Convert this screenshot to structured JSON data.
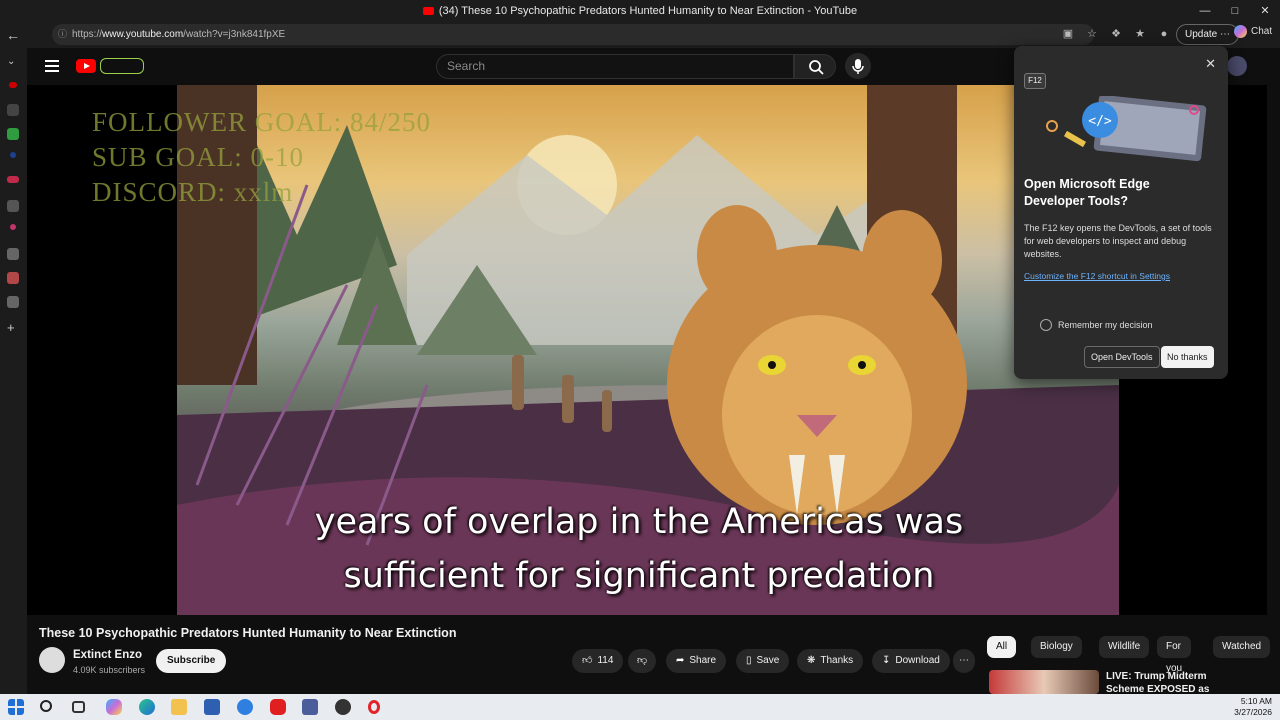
{
  "window": {
    "title": "(34) These 10 Psychopathic Predators Hunted Humanity to Near Extinction - YouTube",
    "controls": [
      "—",
      "□",
      "✕"
    ]
  },
  "browser": {
    "url_prefix": "https://",
    "url_host": "www.youtube.com",
    "url_path": "/watch?v=j3nk841fpXE",
    "update_label": "Update",
    "chat_label": "Chat"
  },
  "masthead": {
    "search_placeholder": "Search"
  },
  "video": {
    "overlay_lines": [
      "FOLLOWER GOAL: 84/250",
      "SUB GOAL: 0-10",
      "DISCORD: xxlm"
    ],
    "caption_lines": [
      "years of overlap in the Americas was",
      "sufficient for significant predation"
    ]
  },
  "meta": {
    "title": "These 10 Psychopathic Predators Hunted Humanity to Near Extinction",
    "channel_name": "Extinct Enzo",
    "subscribers": "4.09K subscribers",
    "subscribe_label": "Subscribe",
    "likes": "114",
    "share_label": "Share",
    "save_label": "Save",
    "thanks_label": "Thanks",
    "download_label": "Download",
    "more_label": "⋯"
  },
  "chips": [
    "All",
    "Biology",
    "Wildlife",
    "For you",
    "Watched"
  ],
  "recommendation": {
    "title": "LIVE: Trump Midterm Scheme EXPOSED as EVERYTHING"
  },
  "devtools_popup": {
    "key_badge": "F12",
    "heading": "Open Microsoft Edge Developer Tools?",
    "body": "The F12 key opens the DevTools, a set of tools for web developers to inspect and debug websites.",
    "link": "Customize the F12 shortcut in Settings",
    "remember": "Remember my decision",
    "open_label": "Open DevTools",
    "no_label": "No thanks"
  },
  "taskbar": {
    "time": "5:10 AM",
    "date": "3/27/2026"
  },
  "colors": {
    "accent_red": "#ff0000",
    "link_blue": "#6cb4ff",
    "overlay_text": "#96a03c"
  }
}
